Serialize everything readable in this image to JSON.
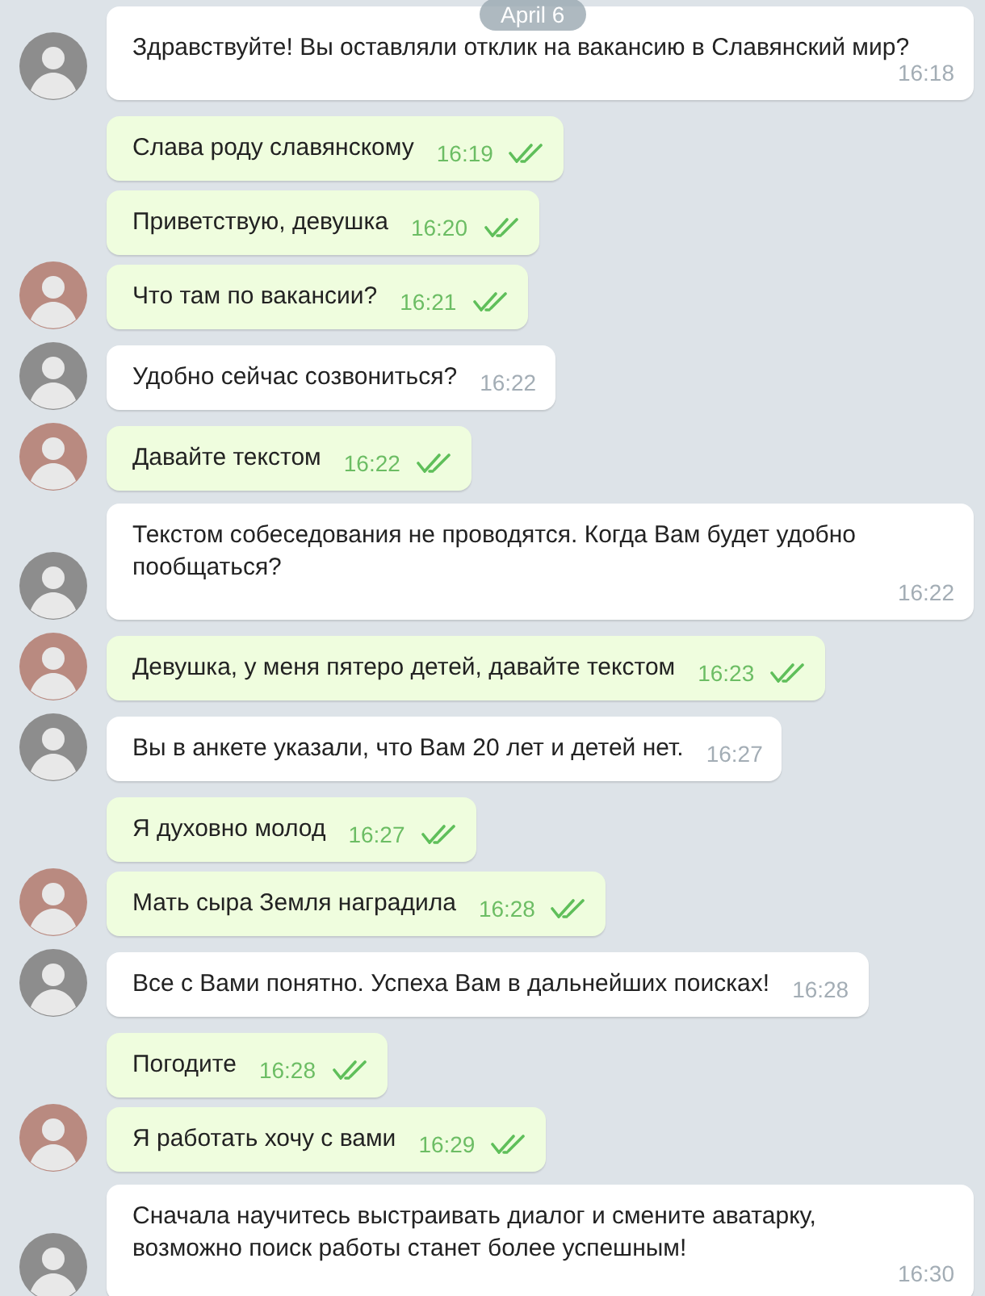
{
  "date_badge": "April 6",
  "messages": [
    {
      "kind": "incoming",
      "text": "Здравствуйте! Вы оставляли отклик на вакансию в Славянский мир?",
      "time": "16:18",
      "avatar": true
    },
    {
      "kind": "outgoing",
      "text": "Слава роду славянскому",
      "time": "16:19",
      "read": true,
      "avatar": false
    },
    {
      "kind": "outgoing",
      "text": "Приветствую, девушка",
      "time": "16:20",
      "read": true,
      "avatar": false
    },
    {
      "kind": "outgoing",
      "text": "Что там по вакансии?",
      "time": "16:21",
      "read": true,
      "avatar": true
    },
    {
      "kind": "incoming",
      "text": "Удобно сейчас созвониться?",
      "time": "16:22",
      "avatar": true
    },
    {
      "kind": "outgoing",
      "text": "Давайте текстом",
      "time": "16:22",
      "read": true,
      "avatar": true
    },
    {
      "kind": "incoming",
      "text": "Текстом собеседования не проводятся. Когда Вам будет удобно пообщаться?",
      "time": "16:22",
      "avatar": true
    },
    {
      "kind": "outgoing",
      "text": "Девушка, у меня пятеро детей, давайте текстом",
      "time": "16:23",
      "read": true,
      "avatar": true
    },
    {
      "kind": "incoming",
      "text": "Вы в анкете указали, что Вам 20 лет и детей нет.",
      "time": "16:27",
      "avatar": true
    },
    {
      "kind": "outgoing",
      "text": "Я духовно молод",
      "time": "16:27",
      "read": true,
      "avatar": false
    },
    {
      "kind": "outgoing",
      "text": "Мать сыра Земля наградила",
      "time": "16:28",
      "read": true,
      "avatar": true
    },
    {
      "kind": "incoming",
      "text": "Все с Вами понятно. Успеха Вам в дальнейших поисках!",
      "time": "16:28",
      "avatar": true
    },
    {
      "kind": "outgoing",
      "text": "Погодите",
      "time": "16:28",
      "read": true,
      "avatar": false
    },
    {
      "kind": "outgoing",
      "text": "Я работать хочу с вами",
      "time": "16:29",
      "read": true,
      "avatar": true
    },
    {
      "kind": "incoming",
      "text": "Сначала научитесь выстраивать диалог и смените аватарку, возможно поиск работы станет более успешным!",
      "time": "16:30",
      "avatar": true
    }
  ]
}
